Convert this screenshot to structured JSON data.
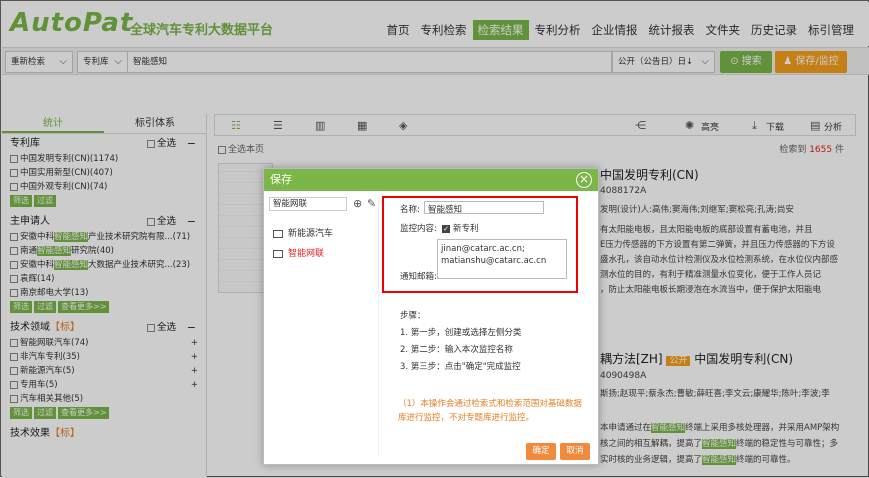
{
  "header": {
    "logo": "AutoPat",
    "subtitle": "全球汽车专利大数据平台",
    "nav": [
      "首页",
      "专利检索",
      "检索结果",
      "专利分析",
      "企业情报",
      "统计报表",
      "文件夹",
      "历史记录",
      "标引管理"
    ],
    "nav_active_index": 2
  },
  "searchbar": {
    "mode": "重新检索",
    "db": "专利库",
    "query": "智能感知",
    "date_field": "公开（公告日）日↓",
    "search_btn": "搜索",
    "save_btn": "保存/监控"
  },
  "left": {
    "tabs": [
      "统计",
      "标引体系"
    ],
    "sections": [
      {
        "title": "专利库",
        "all": "全选",
        "items": [
          "中国发明专利(CN)(1174)",
          "中国实用新型(CN)(407)",
          "中国外观专利(CN)(74)"
        ],
        "btns": [
          "筛选",
          "过滤"
        ]
      },
      {
        "title": "主申请人",
        "all": "全选",
        "items": [
          {
            "pre": "安徽中科",
            "hl": "智能感知",
            "post": "产业技术研究院有限...(71)"
          },
          {
            "pre": "南通",
            "hl": "智能感知",
            "post": "研究院(40)"
          },
          {
            "pre": "安徽中科",
            "hl": "智能感知",
            "post": "大数据产业技术研究...(23)"
          },
          {
            "pre": "袁辉(14)",
            "hl": "",
            "post": ""
          },
          {
            "pre": "南京邮电大学(13)",
            "hl": "",
            "post": ""
          }
        ],
        "btns": [
          "筛选",
          "过滤",
          "查看更多>>"
        ]
      },
      {
        "title": "技术领域",
        "tag": "【标】",
        "all": "全选",
        "items": [
          "智能网联汽车(74)",
          "非汽车专利(35)",
          "新能源汽车(5)",
          "专用车(5)",
          "汽车相关其他(5)"
        ],
        "btns": [
          "筛选",
          "过滤",
          "查看更多>>"
        ]
      },
      {
        "title": "技术效果",
        "tag": "【标】"
      }
    ]
  },
  "toolbar": {
    "highlight": "高亮",
    "download": "下载",
    "analysis": "分析"
  },
  "results": {
    "select_page": "全选本页",
    "count_prefix": "检索到",
    "count": "1655",
    "count_suffix": "件",
    "r1": {
      "title": "中国发明专利(CN)",
      "number": "4088172A",
      "inventors": "发明(设计)人:高伟;窦海伟;刘继军;窦松亮;孔涛;尚安",
      "lines": [
        "有太阳能电板，且太阳能电板的底部设置有蓄电池，并且",
        "E压力传感器的下方设置有第二弹簧，并且压力传感器的下方设",
        "盛水孔，该自动水位计检测仪及水位检测系统，在水位仪内部感",
        "测水位的目的，有利于精准测量水位变化，便于工作人员记",
        "，防止太阳能电板长期浸泡在水流当中，便于保护太阳能电"
      ]
    },
    "r2": {
      "title_pre": "耦方法[ZH]",
      "badge": "公开",
      "title_post": "中国发明专利(CN)",
      "number": "4090498A",
      "inventors": "斯扬;赵现平;蔡永杰;曹敏;薛旺喜;李文云;康耀华;陈叶;李波;李",
      "line1_pre": "本申请通过在",
      "line1_hl": "智能感知",
      "line1_post": "终端上采用多核处理器，并采用AMP架构",
      "line2_pre": "核之间的相互解耦，提高了",
      "line2_hl": "智能感知",
      "line2_post": "终端的稳定性与可靠性；多",
      "line3_pre": "实时核的业务逻辑，提高了",
      "line3_hl": "智能感知",
      "line3_post": "终端的可靠性。"
    }
  },
  "modal": {
    "title": "保存",
    "folder_search": "智能网联",
    "folders": [
      "新能源汽车",
      "智能网联"
    ],
    "name_label": "名称:",
    "name_value": "智能感知",
    "monitor_label": "监控内容:",
    "monitor_option": "新专利",
    "email_label": "通知邮箱:",
    "emails": [
      "jinan@catarc.ac.cn;",
      "matianshu@catarc.ac.cn"
    ],
    "steps_title": "步骤：",
    "steps": [
      "1. 第一步，创建或选择左侧分类",
      "2. 第二步：输入本次监控名称",
      "3. 第三步：点击\"确定\"完成监控"
    ],
    "warning": "（1）本操作会通过检索式和检索范围对基础数据库进行监控，不对专题库进行监控。",
    "ok": "确定",
    "cancel": "取消"
  }
}
